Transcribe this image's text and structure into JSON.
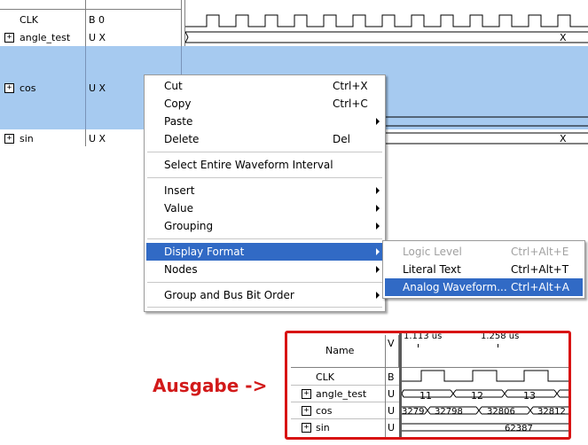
{
  "editor": {
    "rows": [
      {
        "name": "CLK",
        "value": "B 0",
        "expand": false
      },
      {
        "name": "angle_test",
        "value": "U X",
        "expand": true,
        "wave_text": "X"
      },
      {
        "name": "cos",
        "value": "U X",
        "expand": true,
        "selected": true
      },
      {
        "name": "sin",
        "value": "U X",
        "expand": true,
        "wave_text": "X"
      }
    ],
    "expand_glyph": "+"
  },
  "context_menu": {
    "items": [
      {
        "label": "Cut",
        "shortcut": "Ctrl+X"
      },
      {
        "label": "Copy",
        "shortcut": "Ctrl+C"
      },
      {
        "label": "Paste",
        "submenu": true
      },
      {
        "label": "Delete",
        "shortcut": "Del"
      },
      {
        "label": "Select Entire Waveform Interval"
      },
      {
        "label": "Insert",
        "submenu": true
      },
      {
        "label": "Value",
        "submenu": true
      },
      {
        "label": "Grouping",
        "submenu": true
      },
      {
        "label": "Display Format",
        "submenu": true,
        "highlighted": true
      },
      {
        "label": "Nodes",
        "submenu": true
      },
      {
        "label": "Group and Bus Bit Order",
        "submenu": true
      }
    ]
  },
  "submenu": {
    "items": [
      {
        "label": "Logic Level",
        "shortcut": "Ctrl+Alt+E",
        "disabled": true
      },
      {
        "label": "Literal Text",
        "shortcut": "Ctrl+Alt+T"
      },
      {
        "label": "Analog Waveform...",
        "shortcut": "Ctrl+Alt+A",
        "highlighted": true
      }
    ]
  },
  "annotation": {
    "text": "Ausgabe ->",
    "color": "#d21a1a"
  },
  "output_view": {
    "header_name": "Name",
    "header_value": "V",
    "time_markers": [
      "1.113 us",
      "1.258 us"
    ],
    "rows": [
      {
        "name": "CLK",
        "value": "B",
        "expand": false
      },
      {
        "name": "angle_test",
        "value": "U",
        "expand": true,
        "segments": [
          "11",
          "12",
          "13"
        ]
      },
      {
        "name": "cos",
        "value": "U",
        "expand": true,
        "segments": [
          "3279",
          "32798",
          "32806",
          "32812"
        ]
      },
      {
        "name": "sin",
        "value": "U",
        "expand": true,
        "segments": [
          "62387"
        ]
      }
    ]
  },
  "colors": {
    "selection": "#a6caf0",
    "menu_highlight": "#316ac5",
    "frame_red": "#d81414",
    "grid": "#808080"
  }
}
